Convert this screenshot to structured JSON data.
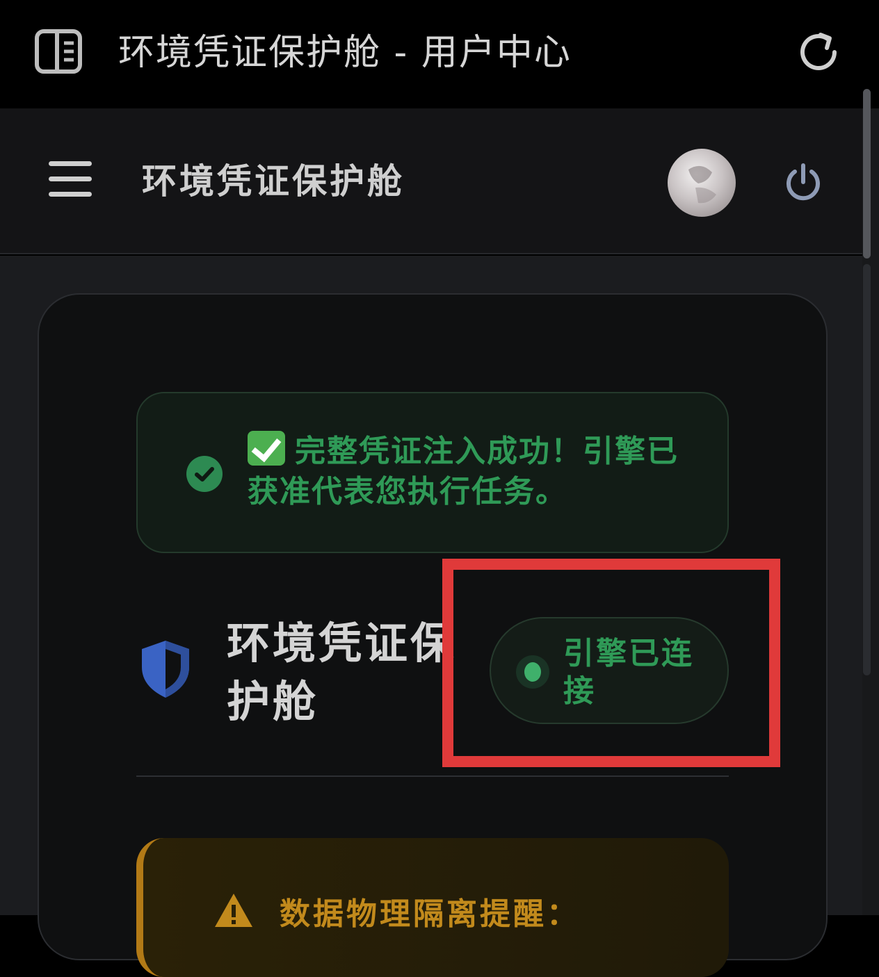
{
  "browser": {
    "title": "环境凭证保护舱 - 用户中心",
    "left_icon": "sidebar-toggle-icon",
    "right_icon": "reload-icon"
  },
  "header": {
    "title": "环境凭证保护舱",
    "menu_icon": "hamburger-menu-icon",
    "avatar_icon": "avatar",
    "power_icon": "power-icon"
  },
  "success_alert": {
    "message": "完整凭证注入成功！引擎已获准代表您执行任务。",
    "icon": "check-circle-icon",
    "color": "#2f9a57"
  },
  "vault": {
    "title": "环境凭证保护舱",
    "icon": "shield-icon",
    "status_label": "引擎已连接",
    "status_color": "#3fb06b"
  },
  "warning_alert": {
    "title": "数据物理隔离提醒：",
    "icon": "warning-icon",
    "color": "#c28a1c"
  },
  "colors": {
    "highlight": "#e03a3a",
    "shield": "#3a63c4"
  }
}
